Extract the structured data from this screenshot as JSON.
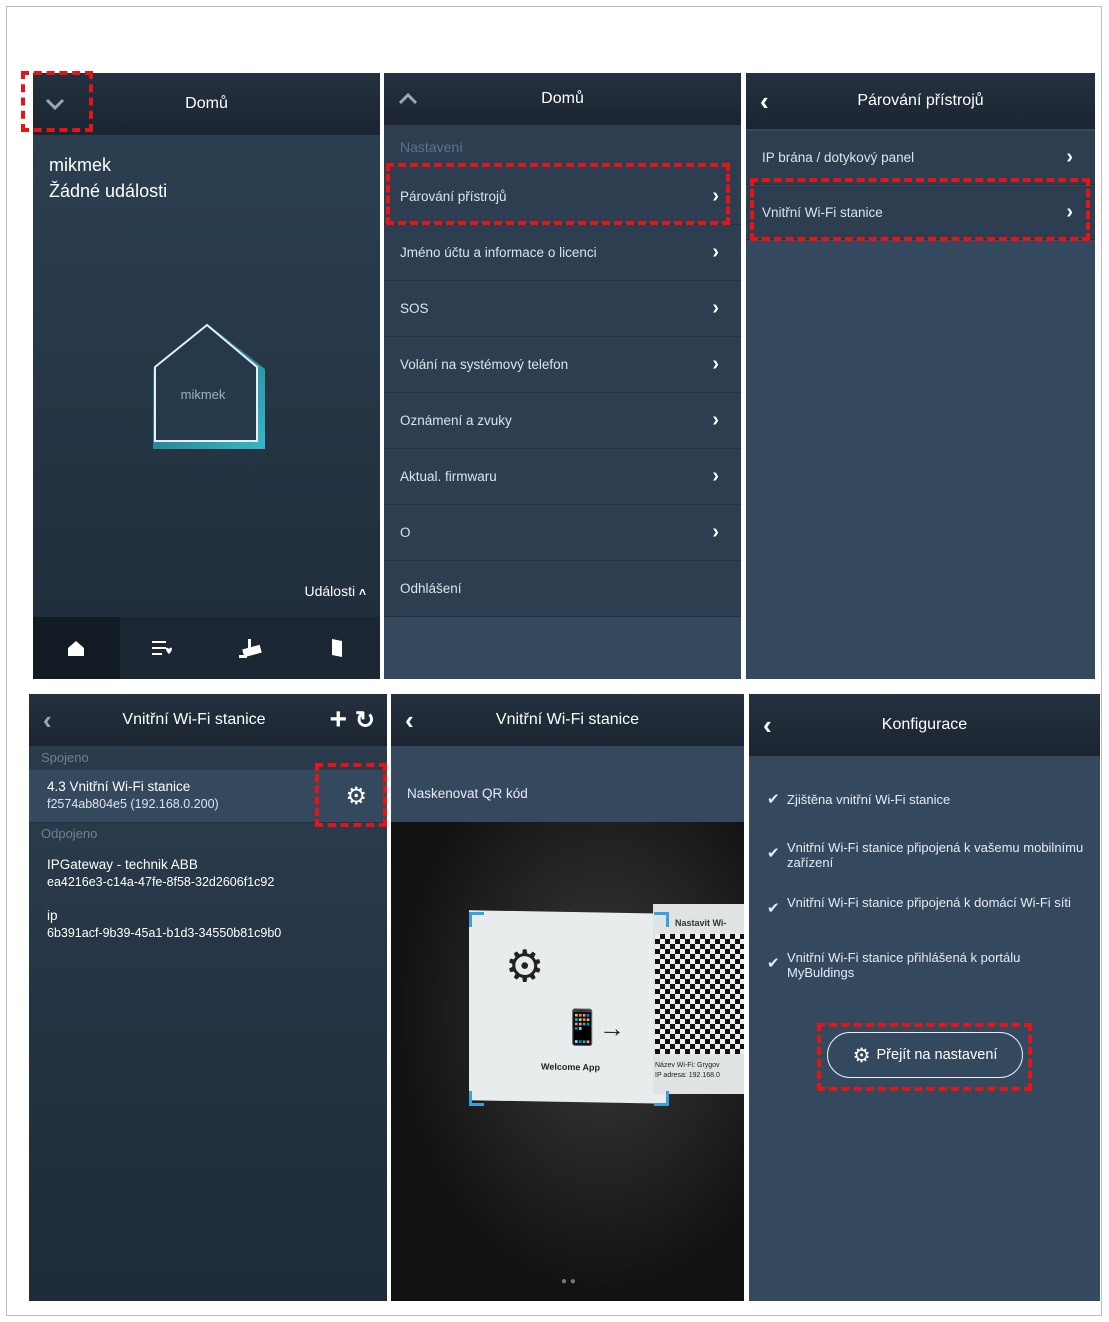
{
  "p1": {
    "title": "Domů",
    "account": "mikmek",
    "status": "Žádné události",
    "house_label": "mikmek",
    "events_label": "Události"
  },
  "p2": {
    "title": "Domů",
    "section": "Nastavení",
    "items": [
      "Párování přístrojů",
      "Jméno účtu a informace o licenci",
      "SOS",
      "Volání na systémový telefon",
      "Oznámení a zvuky",
      "Aktual. firmwaru",
      "O",
      "Odhlášení"
    ]
  },
  "p3": {
    "title": "Párování přístrojů",
    "items": [
      "IP brána / dotykový panel",
      "Vnitřní Wi-Fi stanice"
    ]
  },
  "p4": {
    "title": "Vnitřní Wi-Fi stanice",
    "connected_header": "Spojeno",
    "disconnected_header": "Odpojeno",
    "connected": [
      {
        "name": "4.3 Vnitřní Wi-Fi stanice",
        "id": "f2574ab804e5 (192.168.0.200)"
      }
    ],
    "disconnected": [
      {
        "name": "IPGateway - technik ABB",
        "id": "ea4216e3-c14a-47fe-8f58-32d2606f1c92"
      },
      {
        "name": "ip",
        "id": "6b391acf-9b39-45a1-b1d3-34550b81c9b0"
      }
    ]
  },
  "p5": {
    "title": "Vnitřní Wi-Fi stanice",
    "scan_label": "Naskenovat QR kód",
    "card": {
      "app_label": "Welcome App",
      "wifi_title": "Nastavit Wi-",
      "wifi_name": "Název Wi-Fi: Grygov",
      "ip_line": "IP adresa: 192.168.0"
    }
  },
  "p6": {
    "title": "Konfigurace",
    "checks": [
      "Zjištěna vnitřní Wi-Fi stanice",
      "Vnitřní Wi-Fi stanice připojená k vašemu mobilnímu zařízení",
      "Vnitřní Wi-Fi stanice připojená k domácí Wi-Fi síti",
      "Vnitřní Wi-Fi stanice přihlášená k portálu MyBuldings"
    ],
    "settings_button": "Přejít na nastavení"
  },
  "colors": {
    "highlight": "#e51515",
    "panel_bg": "#2c3e50",
    "header_bg": "#1b2531"
  },
  "icons": [
    "chevron-down-icon",
    "chevron-up-icon",
    "chevron-right-icon",
    "back-icon",
    "plus-icon",
    "refresh-icon",
    "gear-icon",
    "home-icon",
    "favorites-icon",
    "camera-icon",
    "door-icon",
    "check-icon"
  ]
}
